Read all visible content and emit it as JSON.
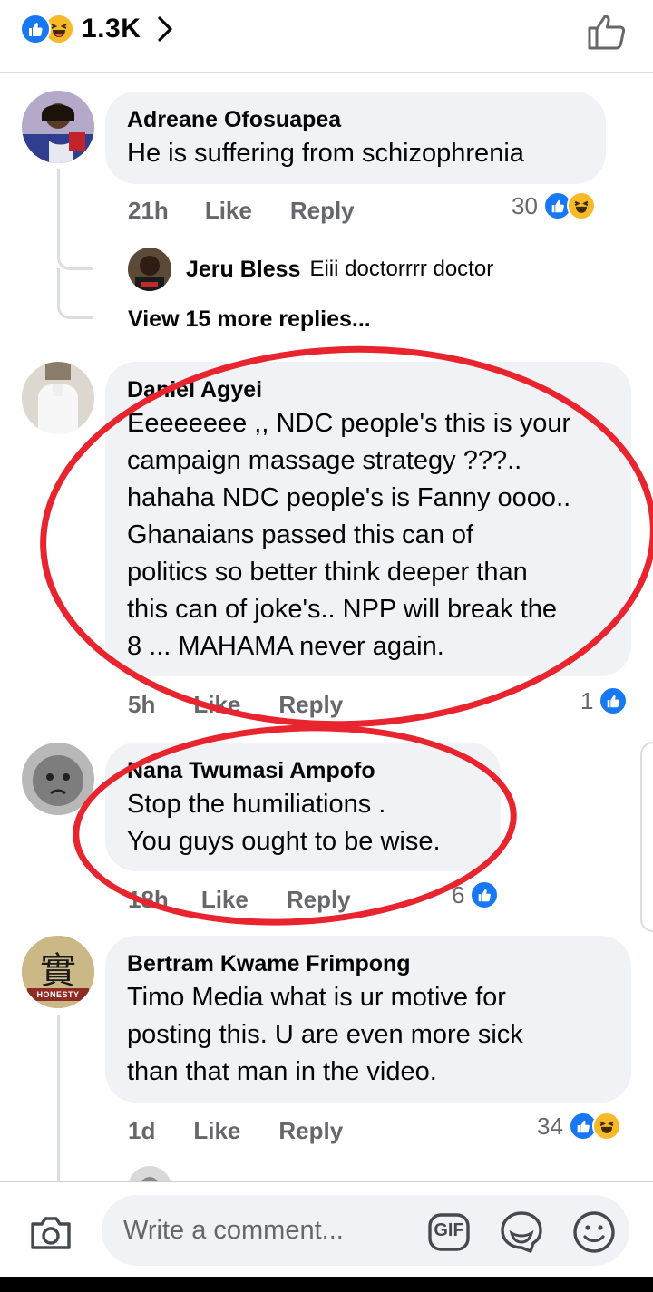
{
  "header": {
    "reaction_count": "1.3K"
  },
  "comments": [
    {
      "author": "Adreane Ofosuapea",
      "text": "He is suffering from schizophrenia",
      "time": "21h",
      "like_label": "Like",
      "reply_label": "Reply",
      "reaction_count": "30",
      "replies_preview": {
        "author": "Jeru Bless",
        "text": "Eiii doctorrrr doctor",
        "view_more": "View 15 more replies..."
      }
    },
    {
      "author": "Daniel Agyei",
      "text": " Eeeeeeee ,, NDC people's this is your\ncampaign massage strategy ???..\nhahaha NDC people's is Fanny oooo..\nGhanaians passed this can of\npolitics so better think deeper  than\nthis can of joke's.. NPP will break the\n8 ... MAHAMA never again.",
      "time": "5h",
      "like_label": "Like",
      "reply_label": "Reply",
      "reaction_count": "1"
    },
    {
      "author": "Nana Twumasi Ampofo",
      "text": "Stop the humiliations .\nYou guys ought to be wise.",
      "time": "18h",
      "like_label": "Like",
      "reply_label": "Reply",
      "reaction_count": "6"
    },
    {
      "author": "Bertram Kwame Frimpong",
      "text": "Timo Media what is ur motive for\nposting this. U are even more sick\nthan that man in the video.",
      "time": "1d",
      "like_label": "Like",
      "reply_label": "Reply",
      "reaction_count": "34",
      "avatar_label": "HONESTY",
      "avatar_glyph": "實"
    }
  ],
  "footer": {
    "placeholder": "Write a comment...",
    "gif_label": "GIF"
  },
  "colors": {
    "like_blue": "#1877f2",
    "haha_yellow": "#f7b928",
    "annotation_red": "#e8252e",
    "bubble_bg": "#f0f2f5",
    "meta_gray": "#65676b"
  }
}
